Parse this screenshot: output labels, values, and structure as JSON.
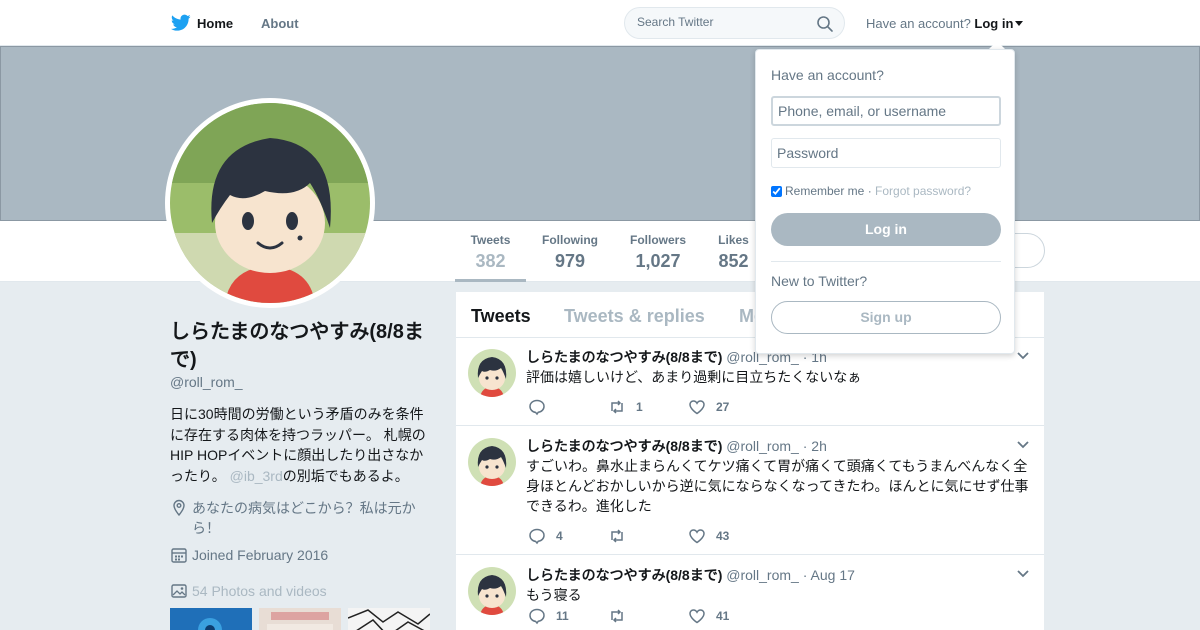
{
  "nav": {
    "home_label": "Home",
    "about_label": "About",
    "account_prompt": "Have an account?",
    "login_label": "Log in"
  },
  "search": {
    "placeholder": "Search Twitter"
  },
  "stats": [
    {
      "label": "Tweets",
      "value": "382"
    },
    {
      "label": "Following",
      "value": "979"
    },
    {
      "label": "Followers",
      "value": "1,027"
    },
    {
      "label": "Likes",
      "value": "852"
    }
  ],
  "profile": {
    "name": "しらたまのなつやすみ(8/8まで)",
    "handle": "@roll_rom_",
    "bio_before": "日に30時間の労働という矛盾のみを条件に存在する肉体を持つラッパー。 札幌のHIP HOPイベントに顔出したり出さなかったり。",
    "bio_mention": "@ib_3rd",
    "bio_after": "の別垢でもあるよ。",
    "location": "あなたの病気はどこから？私は元から！",
    "joined": "Joined February 2016",
    "photos": "54 Photos and videos"
  },
  "tabs": [
    "Tweets",
    "Tweets & replies",
    "Media"
  ],
  "tweets": [
    {
      "name": "しらたまのなつやすみ(8/8まで)",
      "handle": "@roll_rom_",
      "time": "· 1h",
      "text": "評価は嬉しいけど、あまり過剰に目立ちたくないなぁ",
      "replies": "",
      "retweets": "1",
      "likes": "27"
    },
    {
      "name": "しらたまのなつやすみ(8/8まで)",
      "handle": "@roll_rom_",
      "time": "· 2h",
      "text": "すごいわ。鼻水止まらんくてケツ痛くて胃が痛くて頭痛くてもうまんべんなく全身ほとんどおかしいから逆に気にならなくなってきたわ。ほんとに気にせず仕事できるわ。進化した",
      "replies": "4",
      "retweets": "",
      "likes": "43"
    },
    {
      "name": "しらたまのなつやすみ(8/8まで)",
      "handle": "@roll_rom_",
      "time": "· Aug 17",
      "text": "もう寝る",
      "replies": "11",
      "retweets": "",
      "likes": "41"
    }
  ],
  "login": {
    "title": "Have an account?",
    "username_placeholder": "Phone, email, or username",
    "password_placeholder": "Password",
    "remember": "Remember me",
    "sep": " · ",
    "forgot": "Forgot password?",
    "button": "Log in",
    "new_prompt": "New to Twitter?",
    "signup": "Sign up"
  },
  "colors": {
    "brand": "#1da1f2",
    "muted": "#657786",
    "disabled": "#aab8c2",
    "banner": "#aab8c2"
  }
}
